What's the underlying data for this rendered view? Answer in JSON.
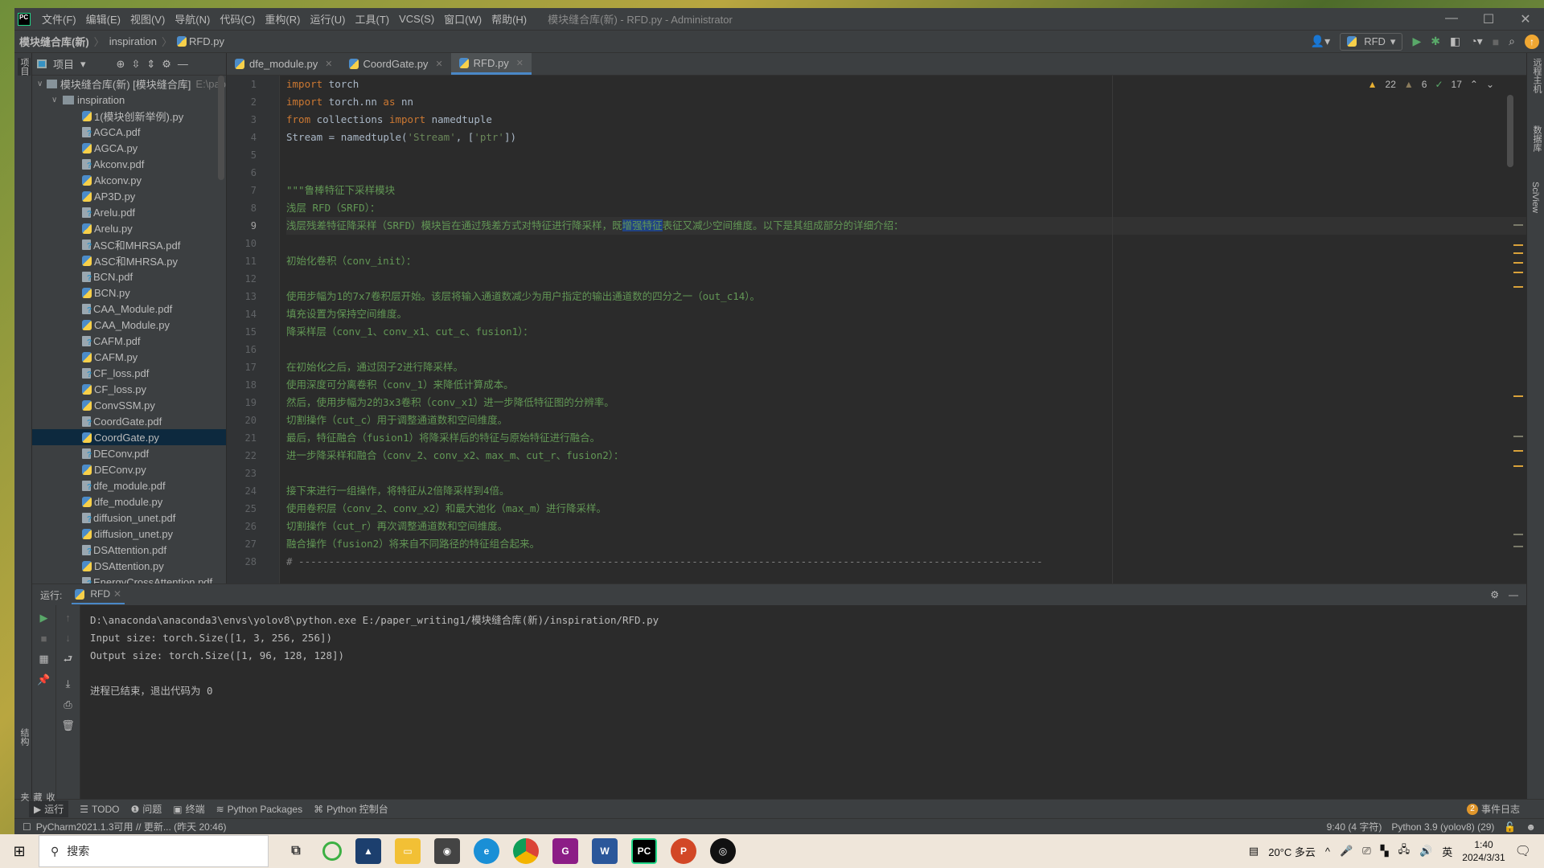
{
  "window": {
    "title": "模块缝合库(新) - RFD.py - Administrator",
    "menu": [
      "文件(F)",
      "编辑(E)",
      "视图(V)",
      "导航(N)",
      "代码(C)",
      "重构(R)",
      "运行(U)",
      "工具(T)",
      "VCS(S)",
      "窗口(W)",
      "帮助(H)"
    ],
    "controls": {
      "minimize": "—",
      "maximize": "☐",
      "close": "✕"
    }
  },
  "breadcrumb": [
    "模块缝合库(新)",
    "inspiration",
    "RFD.py"
  ],
  "toolbar": {
    "run_config": "RFD"
  },
  "left_strip": {
    "project": "项目",
    "structure": "结构",
    "favorites": "收藏夹"
  },
  "right_strip": {
    "remote": "远程主机",
    "database": "数据库",
    "sciview": "SciView"
  },
  "project_panel": {
    "title": "项目",
    "root": {
      "label": "模块缝合库(新) [模块缝合库]",
      "hint": "E:\\pap"
    },
    "folder": "inspiration",
    "files": [
      {
        "name": "1(模块创新举例).py",
        "type": "py"
      },
      {
        "name": "AGCA.pdf",
        "type": "pdf"
      },
      {
        "name": "AGCA.py",
        "type": "py"
      },
      {
        "name": "Akconv.pdf",
        "type": "pdf"
      },
      {
        "name": "Akconv.py",
        "type": "py"
      },
      {
        "name": "AP3D.py",
        "type": "py"
      },
      {
        "name": "Arelu.pdf",
        "type": "pdf"
      },
      {
        "name": "Arelu.py",
        "type": "py"
      },
      {
        "name": "ASC和MHRSA.pdf",
        "type": "pdf"
      },
      {
        "name": "ASC和MHRSA.py",
        "type": "py"
      },
      {
        "name": "BCN.pdf",
        "type": "pdf"
      },
      {
        "name": "BCN.py",
        "type": "py"
      },
      {
        "name": "CAA_Module.pdf",
        "type": "pdf"
      },
      {
        "name": "CAA_Module.py",
        "type": "py"
      },
      {
        "name": "CAFM.pdf",
        "type": "pdf"
      },
      {
        "name": "CAFM.py",
        "type": "py"
      },
      {
        "name": "CF_loss.pdf",
        "type": "pdf"
      },
      {
        "name": "CF_loss.py",
        "type": "py"
      },
      {
        "name": "ConvSSM.py",
        "type": "py"
      },
      {
        "name": "CoordGate.pdf",
        "type": "pdf"
      },
      {
        "name": "CoordGate.py",
        "type": "py",
        "selected": true
      },
      {
        "name": "DEConv.pdf",
        "type": "pdf"
      },
      {
        "name": "DEConv.py",
        "type": "py"
      },
      {
        "name": "dfe_module.pdf",
        "type": "pdf"
      },
      {
        "name": "dfe_module.py",
        "type": "py"
      },
      {
        "name": "diffusion_unet.pdf",
        "type": "pdf"
      },
      {
        "name": "diffusion_unet.py",
        "type": "py"
      },
      {
        "name": "DSAttention.pdf",
        "type": "pdf"
      },
      {
        "name": "DSAttention.py",
        "type": "py"
      },
      {
        "name": "EnergyCrossAttention.pdf",
        "type": "pdf"
      }
    ]
  },
  "tabs": [
    {
      "label": "dfe_module.py",
      "active": false
    },
    {
      "label": "CoordGate.py",
      "active": false
    },
    {
      "label": "RFD.py",
      "active": true
    }
  ],
  "inspections": {
    "warnings": "22",
    "weak_warnings": "6",
    "typos": "17"
  },
  "code": {
    "current_line": 9,
    "lines": [
      [
        {
          "t": "import",
          "c": "kw"
        },
        {
          "t": " torch"
        }
      ],
      [
        {
          "t": "import",
          "c": "kw"
        },
        {
          "t": " torch.nn "
        },
        {
          "t": "as",
          "c": "kw"
        },
        {
          "t": " nn"
        }
      ],
      [
        {
          "t": "from",
          "c": "kw"
        },
        {
          "t": " collections "
        },
        {
          "t": "import",
          "c": "kw"
        },
        {
          "t": " namedtuple"
        }
      ],
      [
        {
          "t": "Stream = namedtuple("
        },
        {
          "t": "'Stream'",
          "c": "str"
        },
        {
          "t": ", ["
        },
        {
          "t": "'ptr'",
          "c": "str"
        },
        {
          "t": "])"
        }
      ],
      [],
      [],
      [
        {
          "t": "\"\"\"鲁棒特征下采样模块",
          "c": "doc"
        }
      ],
      [
        {
          "t": "浅层 RFD（SRFD）：",
          "c": "doc"
        }
      ],
      [
        {
          "t": "浅层残差特征降采样（SRFD）模块旨在通过残差方式对特征进行降采样，既",
          "c": "doc"
        },
        {
          "t": "增强特征",
          "c": "doc sel"
        },
        {
          "t": "表征又减少空间维度。以下是其组成部分的详细介绍：",
          "c": "doc"
        }
      ],
      [],
      [
        {
          "t": "初始化卷积（conv_init）：",
          "c": "doc"
        }
      ],
      [],
      [
        {
          "t": "使用步幅为1的7x7卷积层开始。该层将输入通道数减少为用户指定的输出通道数的四分之一（out_c14）。",
          "c": "doc"
        }
      ],
      [
        {
          "t": "填充设置为保持空间维度。",
          "c": "doc"
        }
      ],
      [
        {
          "t": "降采样层（conv_1、conv_x1、cut_c、fusion1）：",
          "c": "doc"
        }
      ],
      [],
      [
        {
          "t": "在初始化之后，通过因子2进行降采样。",
          "c": "doc"
        }
      ],
      [
        {
          "t": "使用深度可分离卷积（conv_1）来降低计算成本。",
          "c": "doc"
        }
      ],
      [
        {
          "t": "然后，使用步幅为2的3x3卷积（conv_x1）进一步降低特征图的分辨率。",
          "c": "doc"
        }
      ],
      [
        {
          "t": "切割操作（cut_c）用于调整通道数和空间维度。",
          "c": "doc"
        }
      ],
      [
        {
          "t": "最后，特征融合（fusion1）将降采样后的特征与原始特征进行融合。",
          "c": "doc"
        }
      ],
      [
        {
          "t": "进一步降采样和融合（conv_2、conv_x2、max_m、cut_r、fusion2）：",
          "c": "doc"
        }
      ],
      [],
      [
        {
          "t": "接下来进行一组操作，将特征从2倍降采样到4倍。",
          "c": "doc"
        }
      ],
      [
        {
          "t": "使用卷积层（conv_2、conv_x2）和最大池化（max_m）进行降采样。",
          "c": "doc"
        }
      ],
      [
        {
          "t": "切割操作（cut_r）再次调整通道数和空间维度。",
          "c": "doc"
        }
      ],
      [
        {
          "t": "融合操作（fusion2）将来自不同路径的特征组合起来。",
          "c": "doc"
        }
      ],
      [
        {
          "t": "# ---------------------------------------------------------------------------------------------------------------------------",
          "c": "cmt"
        }
      ]
    ]
  },
  "run_panel": {
    "label": "运行:",
    "tab": "RFD",
    "output": [
      "D:\\anaconda\\anaconda3\\envs\\yolov8\\python.exe E:/paper_writing1/模块缝合库(新)/inspiration/RFD.py",
      "Input size: torch.Size([1, 3, 256, 256])",
      "Output size: torch.Size([1, 96, 128, 128])",
      "",
      "进程已结束，退出代码为 0"
    ]
  },
  "tool_tabs": [
    "运行",
    "TODO",
    "问题",
    "终端",
    "Python Packages",
    "Python 控制台"
  ],
  "event_log": {
    "count": "2",
    "label": "事件日志"
  },
  "statusbar": {
    "message": "PyCharm2021.1.3可用 // 更新... (昨天 20:46)",
    "position": "9:40 (4 字符)",
    "interpreter": "Python 3.9 (yolov8) (29)"
  },
  "taskbar": {
    "search_placeholder": "搜索",
    "weather": "20°C  多云",
    "ime": "英",
    "time": "1:40",
    "date": "2024/3/31"
  }
}
